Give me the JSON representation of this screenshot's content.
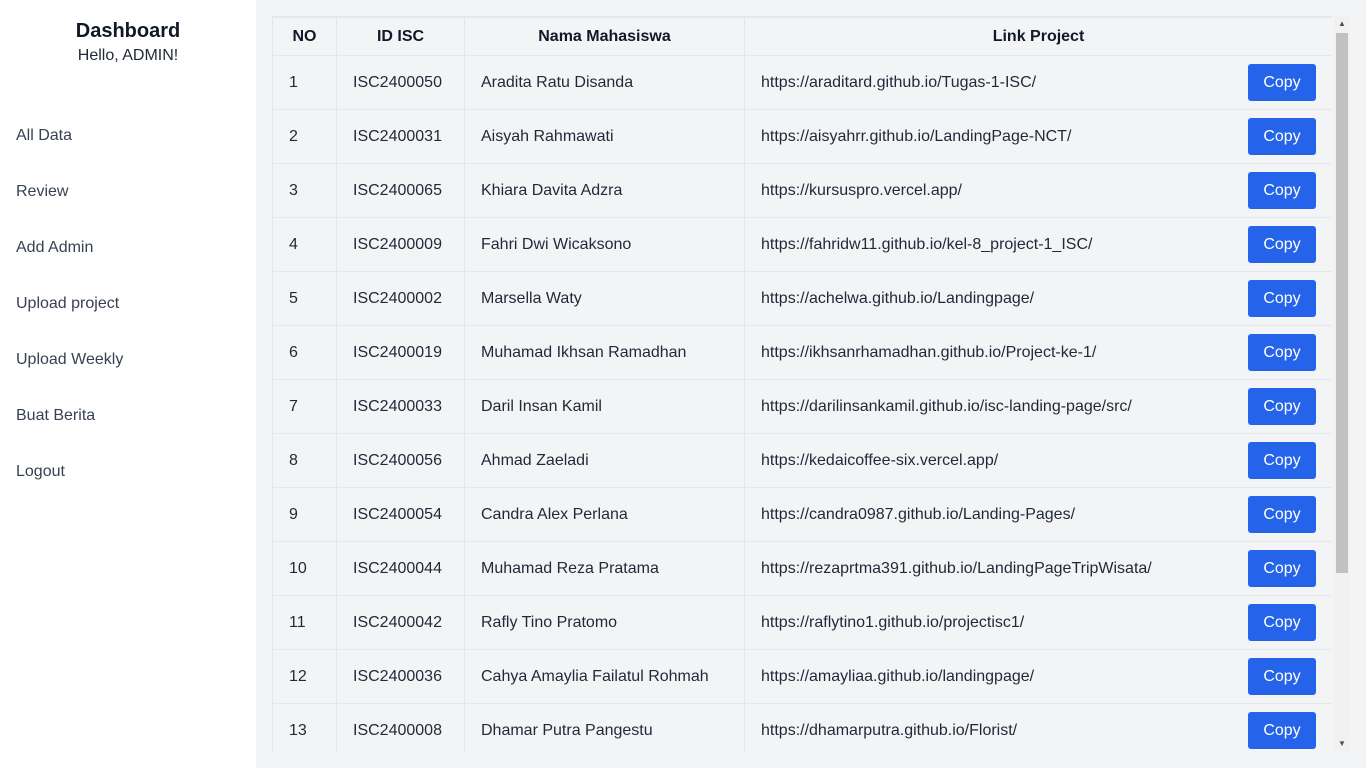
{
  "sidebar": {
    "title": "Dashboard",
    "greeting": "Hello, ADMIN!",
    "items": [
      {
        "label": "All Data"
      },
      {
        "label": "Review"
      },
      {
        "label": "Add Admin"
      },
      {
        "label": "Upload project"
      },
      {
        "label": "Upload Weekly"
      },
      {
        "label": "Buat Berita"
      },
      {
        "label": "Logout"
      }
    ]
  },
  "table": {
    "headers": [
      "NO",
      "ID ISC",
      "Nama Mahasiswa",
      "Link Project"
    ],
    "copy_label": "Copy",
    "rows": [
      {
        "no": "1",
        "id": "ISC2400050",
        "name": "Aradita Ratu Disanda",
        "link": "https://araditard.github.io/Tugas-1-ISC/"
      },
      {
        "no": "2",
        "id": "ISC2400031",
        "name": "Aisyah Rahmawati",
        "link": "https://aisyahrr.github.io/LandingPage-NCT/"
      },
      {
        "no": "3",
        "id": "ISC2400065",
        "name": "Khiara Davita Adzra",
        "link": "https://kursuspro.vercel.app/"
      },
      {
        "no": "4",
        "id": "ISC2400009",
        "name": "Fahri Dwi Wicaksono",
        "link": "https://fahridw11.github.io/kel-8_project-1_ISC/"
      },
      {
        "no": "5",
        "id": "ISC2400002",
        "name": "Marsella Waty",
        "link": "https://achelwa.github.io/Landingpage/"
      },
      {
        "no": "6",
        "id": "ISC2400019",
        "name": "Muhamad Ikhsan Ramadhan",
        "link": "https://ikhsanrhamadhan.github.io/Project-ke-1/"
      },
      {
        "no": "7",
        "id": "ISC2400033",
        "name": "Daril Insan Kamil",
        "link": "https://darilinsankamil.github.io/isc-landing-page/src/"
      },
      {
        "no": "8",
        "id": "ISC2400056",
        "name": "Ahmad Zaeladi",
        "link": "https://kedaicoffee-six.vercel.app/"
      },
      {
        "no": "9",
        "id": "ISC2400054",
        "name": "Candra Alex Perlana",
        "link": "https://candra0987.github.io/Landing-Pages/"
      },
      {
        "no": "10",
        "id": "ISC2400044",
        "name": "Muhamad Reza Pratama",
        "link": "https://rezaprtma391.github.io/LandingPageTripWisata/"
      },
      {
        "no": "11",
        "id": "ISC2400042",
        "name": "Rafly Tino Pratomo",
        "link": "https://raflytino1.github.io/projectisc1/"
      },
      {
        "no": "12",
        "id": "ISC2400036",
        "name": "Cahya Amaylia Failatul Rohmah",
        "link": "https://amayliaa.github.io/landingpage/"
      },
      {
        "no": "13",
        "id": "ISC2400008",
        "name": "Dhamar Putra Pangestu",
        "link": "https://dhamarputra.github.io/Florist/"
      }
    ]
  },
  "colors": {
    "accent": "#2563eb",
    "background": "#f3f4f6",
    "sidebar": "#ffffff"
  }
}
